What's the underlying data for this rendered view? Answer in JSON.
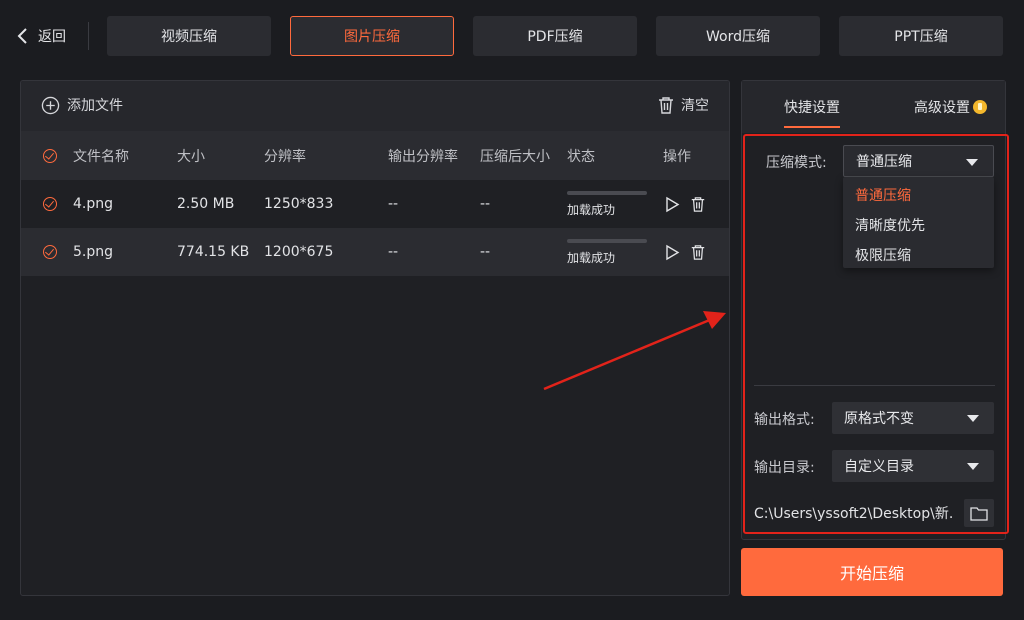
{
  "back_label": "返回",
  "tabs": [
    {
      "label": "视频压缩"
    },
    {
      "label": "图片压缩"
    },
    {
      "label": "PDF压缩"
    },
    {
      "label": "Word压缩"
    },
    {
      "label": "PPT压缩"
    }
  ],
  "toolbar": {
    "add_file": "添加文件",
    "clear": "清空"
  },
  "table": {
    "headers": [
      "文件名称",
      "大小",
      "分辨率",
      "输出分辨率",
      "压缩后大小",
      "状态",
      "操作"
    ],
    "rows": [
      {
        "name": "4.png",
        "size": "2.50 MB",
        "resolution": "1250*833",
        "out_resolution": "--",
        "out_size": "--",
        "status": "加载成功"
      },
      {
        "name": "5.png",
        "size": "774.15 KB",
        "resolution": "1200*675",
        "out_resolution": "--",
        "out_size": "--",
        "status": "加载成功"
      }
    ]
  },
  "settings": {
    "tabs": [
      "快捷设置",
      "高级设置"
    ],
    "mode_label": "压缩模式:",
    "mode_value": "普通压缩",
    "mode_options": [
      "普通压缩",
      "清晰度优先",
      "极限压缩"
    ],
    "format_label": "输出格式:",
    "format_value": "原格式不变",
    "dir_label": "输出目录:",
    "dir_value": "自定义目录",
    "path": "C:\\Users\\yssoft2\\Desktop\\新..."
  },
  "start_button": "开始压缩",
  "colors": {
    "accent": "#ff6a3d",
    "annotation": "#e2231a"
  }
}
